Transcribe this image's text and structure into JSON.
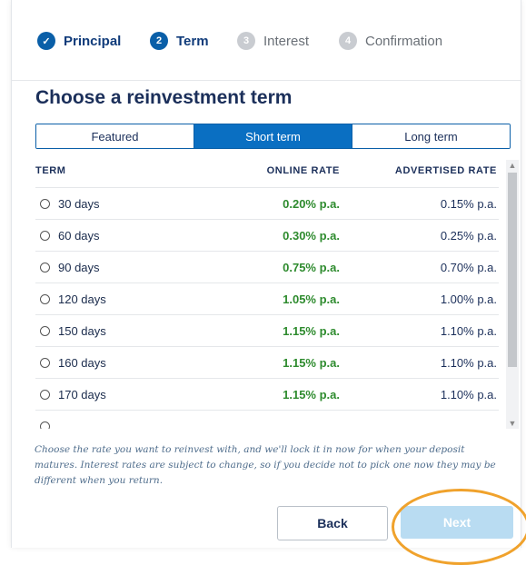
{
  "stepper": {
    "steps": [
      {
        "num": "✓",
        "label": "Principal",
        "state": "done"
      },
      {
        "num": "2",
        "label": "Term",
        "state": "active"
      },
      {
        "num": "3",
        "label": "Interest",
        "state": "pending"
      },
      {
        "num": "4",
        "label": "Confirmation",
        "state": "pending"
      }
    ]
  },
  "heading": "Choose a reinvestment term",
  "tabs": [
    {
      "label": "Featured",
      "selected": false
    },
    {
      "label": "Short term",
      "selected": true
    },
    {
      "label": "Long term",
      "selected": false
    }
  ],
  "table": {
    "headers": {
      "term": "TERM",
      "online": "ONLINE RATE",
      "advertised": "ADVERTISED RATE"
    },
    "rows": [
      {
        "term": "30 days",
        "online": "0.20% p.a.",
        "advertised": "0.15% p.a."
      },
      {
        "term": "60 days",
        "online": "0.30% p.a.",
        "advertised": "0.25% p.a."
      },
      {
        "term": "90 days",
        "online": "0.75% p.a.",
        "advertised": "0.70% p.a."
      },
      {
        "term": "120 days",
        "online": "1.05% p.a.",
        "advertised": "1.00% p.a."
      },
      {
        "term": "150 days",
        "online": "1.15% p.a.",
        "advertised": "1.10% p.a."
      },
      {
        "term": "160 days",
        "online": "1.15% p.a.",
        "advertised": "1.10% p.a."
      },
      {
        "term": "170 days",
        "online": "1.15% p.a.",
        "advertised": "1.10% p.a."
      }
    ]
  },
  "footnote": "Choose the rate you want to reinvest with, and we'll lock it in now for when your deposit matures. Interest rates are subject to change, so if you decide not to pick one now they may be different when you return.",
  "buttons": {
    "back": "Back",
    "next": "Next"
  },
  "colors": {
    "primary": "#0a5fa8",
    "rate_green": "#2e8b2e",
    "next_disabled": "#b9dcf2",
    "highlight": "#f0a22c"
  },
  "icons": {
    "check": "check-icon",
    "radio": "radio-icon",
    "scroll_up": "chevron-up-icon",
    "scroll_down": "chevron-down-icon"
  }
}
